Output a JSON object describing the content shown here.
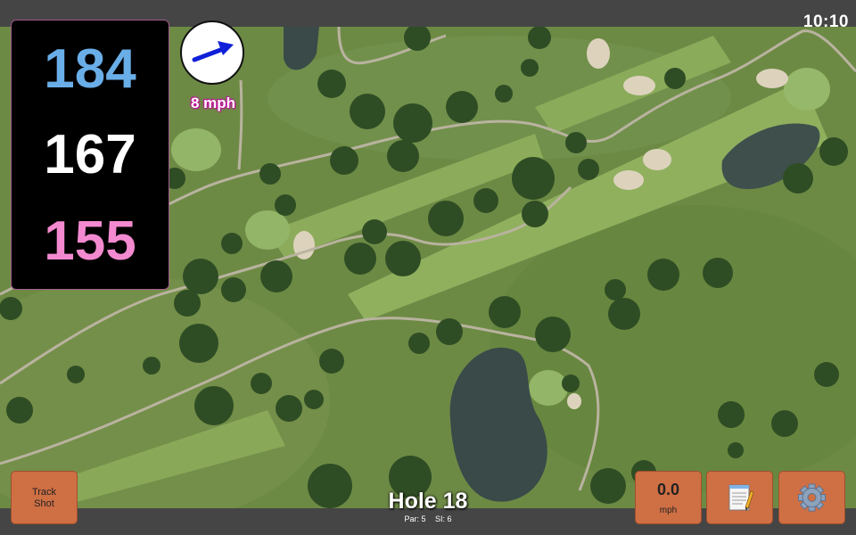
{
  "status": {
    "time": "10:10"
  },
  "distances": {
    "front": "184",
    "middle": "167",
    "back": "155",
    "front_color": "#6aaee8",
    "middle_color": "#ffffff",
    "back_color": "#f38ad0"
  },
  "wind": {
    "speed_label": "8 mph",
    "arrow_color": "#1020d8"
  },
  "hole": {
    "title": "Hole 18",
    "par": "Par: 5",
    "si": "SI: 6"
  },
  "buttons": {
    "track_shot_line1": "Track",
    "track_shot_line2": "Shot",
    "speed_value": "0.0",
    "speed_unit": "mph",
    "notes_icon": "notepad-icon",
    "settings_icon": "gear-icon"
  },
  "colors": {
    "button_bg": "#cf6f44",
    "panel_border": "#a35b8c"
  }
}
